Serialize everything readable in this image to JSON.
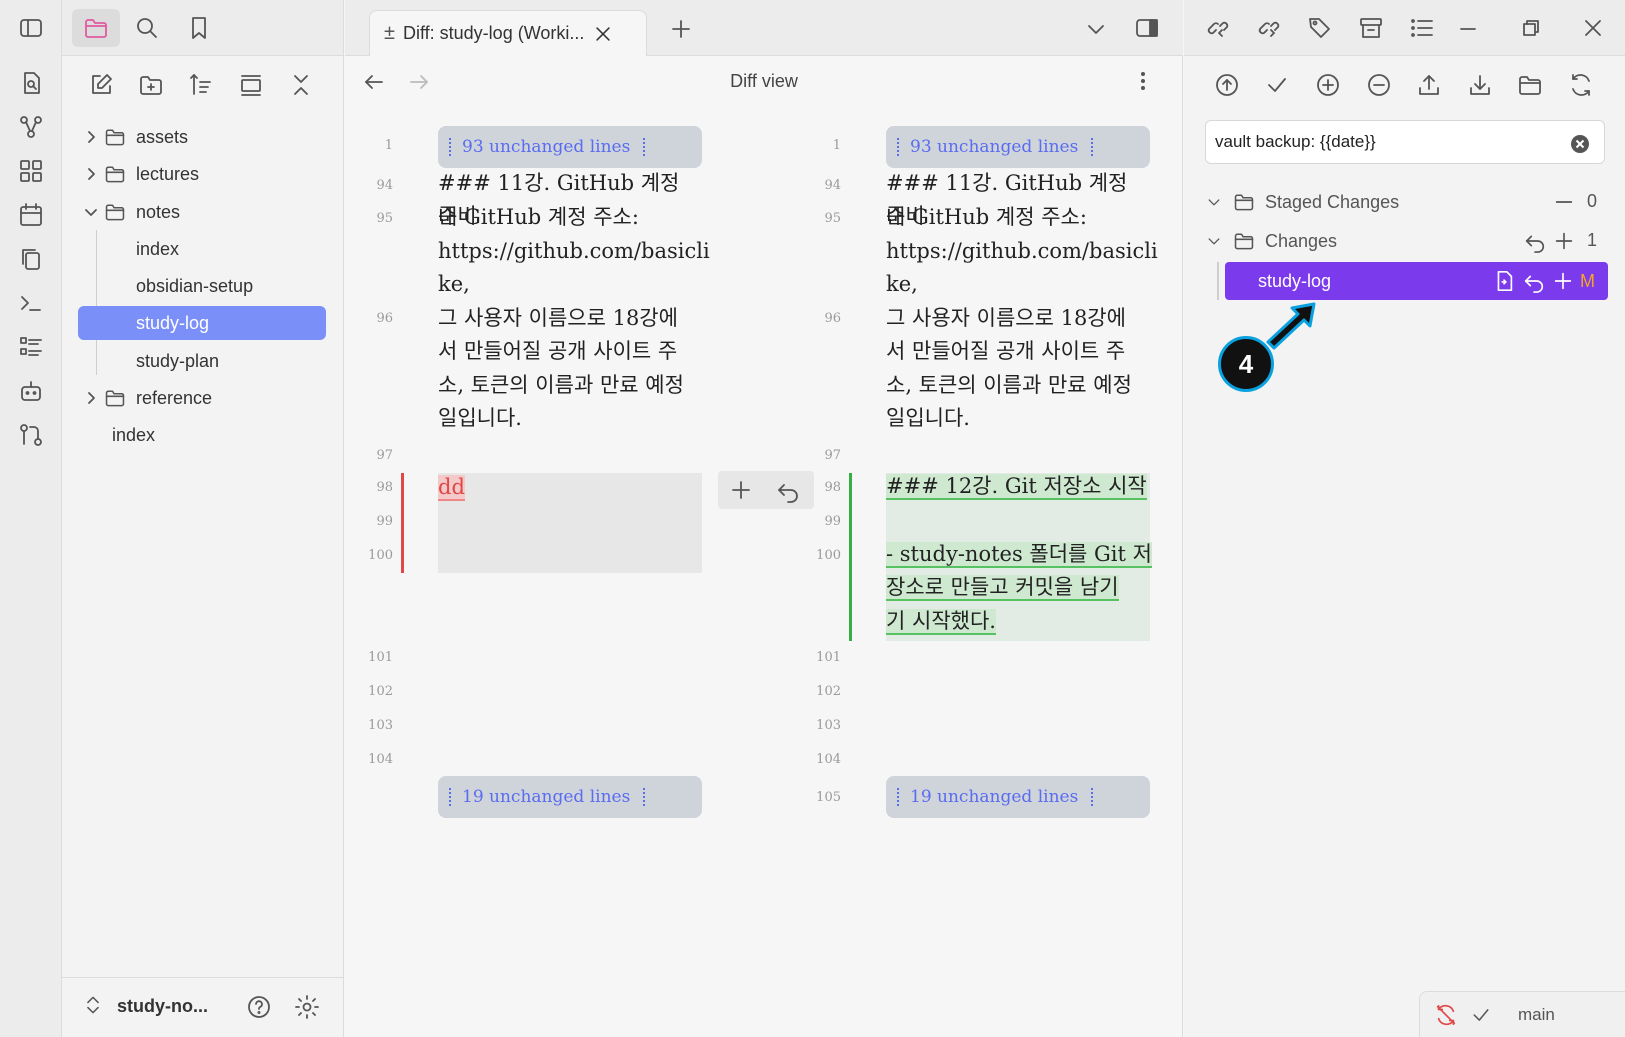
{
  "tab": {
    "title": "Diff: study-log (Worki..."
  },
  "editor": {
    "view_title": "Diff view"
  },
  "explorer": {
    "items": [
      {
        "label": "assets"
      },
      {
        "label": "lectures"
      },
      {
        "label": "notes"
      },
      {
        "label": "index"
      },
      {
        "label": "obsidian-setup"
      },
      {
        "label": "study-log"
      },
      {
        "label": "study-plan"
      },
      {
        "label": "reference"
      },
      {
        "label": "index"
      }
    ],
    "vault_name": "study-no..."
  },
  "diff": {
    "unchanged_top": "93 unchanged lines",
    "unchanged_bottom": "19 unchanged lines",
    "left_lines": [
      "1",
      "94",
      "95",
      "96",
      "97",
      "98",
      "99",
      "100",
      "101",
      "102",
      "103",
      "104"
    ],
    "right_lines": [
      "1",
      "94",
      "95",
      "96",
      "97",
      "98",
      "99",
      "100",
      "101",
      "102",
      "103",
      "104",
      "105"
    ],
    "line94": "### 11강. GitHub 계정 준비",
    "line95a": "내 GitHub 계정 주소:",
    "line95b": "https://github.com/basicli",
    "line95c": "ke,",
    "line96a": "그 사용자 이름으로 18강에",
    "line96b": "서 만들어질 공개 사이트 주",
    "line96c": "소, 토큰의 이름과 만료 예정",
    "line96d": "일입니다.",
    "deleted_text": "dd",
    "added_heading": "### 12강. Git 저장소 시작",
    "added_a": "- study-notes 폴더를 Git 저",
    "added_b": "장소로 만들고 커밋을 남기",
    "added_c": "기 시작했다."
  },
  "git": {
    "commit_message": "vault backup: {{date}}",
    "staged_label": "Staged Changes",
    "staged_count": "0",
    "changes_label": "Changes",
    "changes_count": "1",
    "file_name": "study-log",
    "file_status": "M",
    "step_badge": "4",
    "branch": "main"
  }
}
